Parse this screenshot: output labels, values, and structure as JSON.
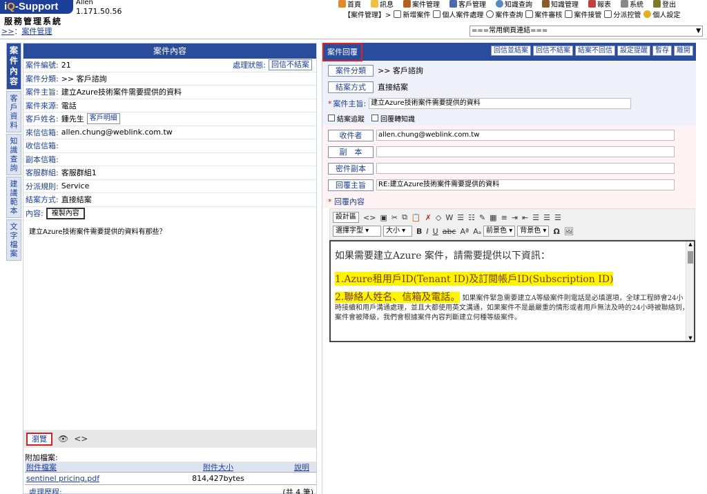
{
  "header": {
    "logo": "iQ-Support",
    "logo_q": "Q",
    "user_name": "Allen",
    "user_ip": "1.171.50.56",
    "system_name": "服務管理系統",
    "top_menu": [
      "首頁",
      "訊息",
      "案件管理",
      "客戶管理",
      "知識查詢",
      "知識管理",
      "報表",
      "系統",
      "登出"
    ],
    "sub_menu": [
      "【案件管理】>",
      "新增案件",
      "個人案件處理",
      "案件查詢",
      "案件審核",
      "案件接管",
      "分派控管",
      "個人設定"
    ],
    "breadcrumb_prefix": ">>",
    "breadcrumb_sep": "：",
    "breadcrumb_current": "案件管理",
    "link_select": "===常用網頁連結==="
  },
  "vtabs": [
    "案件內容",
    "客戶資料",
    "知識查詢",
    "建議範本",
    "文字檔案"
  ],
  "case": {
    "title": "案件內容",
    "number_label": "案件編號:",
    "number": "21",
    "status_label": "處理狀態:",
    "status": "回信不結案",
    "category_label": "案件分類:",
    "category": ">> 客戶諮詢",
    "subject_label": "案件主旨:",
    "subject": "建立Azure技術案件需要提供的資料",
    "source_label": "案件來源:",
    "source": "電話",
    "customer_label": "客戶姓名:",
    "customer": "鍾先生",
    "customer_btn": "客戶明細",
    "from_label": "來信信箱:",
    "from": "allen.chung@weblink.com.tw",
    "to_label": "收信信箱:",
    "to": "",
    "cc_label": "副本信箱:",
    "cc": "",
    "group_label": "客服群組:",
    "group": "客服群組1",
    "rule_label": "分派規則:",
    "rule": "Service",
    "close_label": "結案方式:",
    "close": "直接結案",
    "content_label": "內容:",
    "copy_btn": "複製內容",
    "content": "建立Azure技術案件需要提供的資料有那些？",
    "browse_btn": "瀏覽",
    "attach_label": "附加檔案:",
    "attach_cols": [
      "附件檔案",
      "附件大小",
      "說明"
    ],
    "attachments": [
      {
        "name": "sentinel pricing.pdf",
        "size": "814,427bytes",
        "note": ""
      }
    ],
    "history_label": "處理歷程:",
    "history_count": "(共 4 筆)"
  },
  "reply": {
    "tab": "案件回覆",
    "actions": [
      "回信並結案",
      "回信不結案",
      "結案不回信",
      "設定提醒",
      "暫存",
      "離開"
    ],
    "category_btn": "案件分類",
    "category": ">> 客戶諮詢",
    "close_btn": "結案方式",
    "close": "直接結案",
    "subject_label": "案件主旨:",
    "subject": "建立Azure技術案件需要提供的資料",
    "chk1": "結案追蹤",
    "chk2": "回覆轉知識",
    "to_btn": "收件者",
    "to": "allen.chung@weblink.com.tw",
    "cc_btn": "副　本",
    "cc": "",
    "bcc_btn": "密件副本",
    "bcc": "",
    "subj_btn": "回覆主旨",
    "reply_subject": "RE:建立Azure技術案件需要提供的資料",
    "editor_label": "回覆內容",
    "design_btn": "設計區",
    "font_sel": "選擇字型",
    "size_sel": "大小",
    "fg_sel": "前景色",
    "bg_sel": "背景色",
    "editor_l1": "如果需要建立Azure 案件，請需要提供以下資訊：",
    "editor_l2": "1.Azure租用戶ID(Tenant ID)及訂閱帳戶ID(Subscription ID)",
    "editor_l3_hl": "2.聯絡人姓名、信箱及電話。",
    "editor_l3": "如果案件緊急需要建立A等級案件則電話是必填選項，全球工程師會24小時接續和用戶溝通處理，並且大都使用英文溝通，如果案件不是最嚴重的情形或者用戶無法及時的24小時被聯絡到，案件會被降級，我們會根據案件內容判斷建立何種等級案件。"
  },
  "colors": {
    "primary": "#2a4c9c",
    "accent_red": "#d22",
    "highlight": "#fff500"
  }
}
